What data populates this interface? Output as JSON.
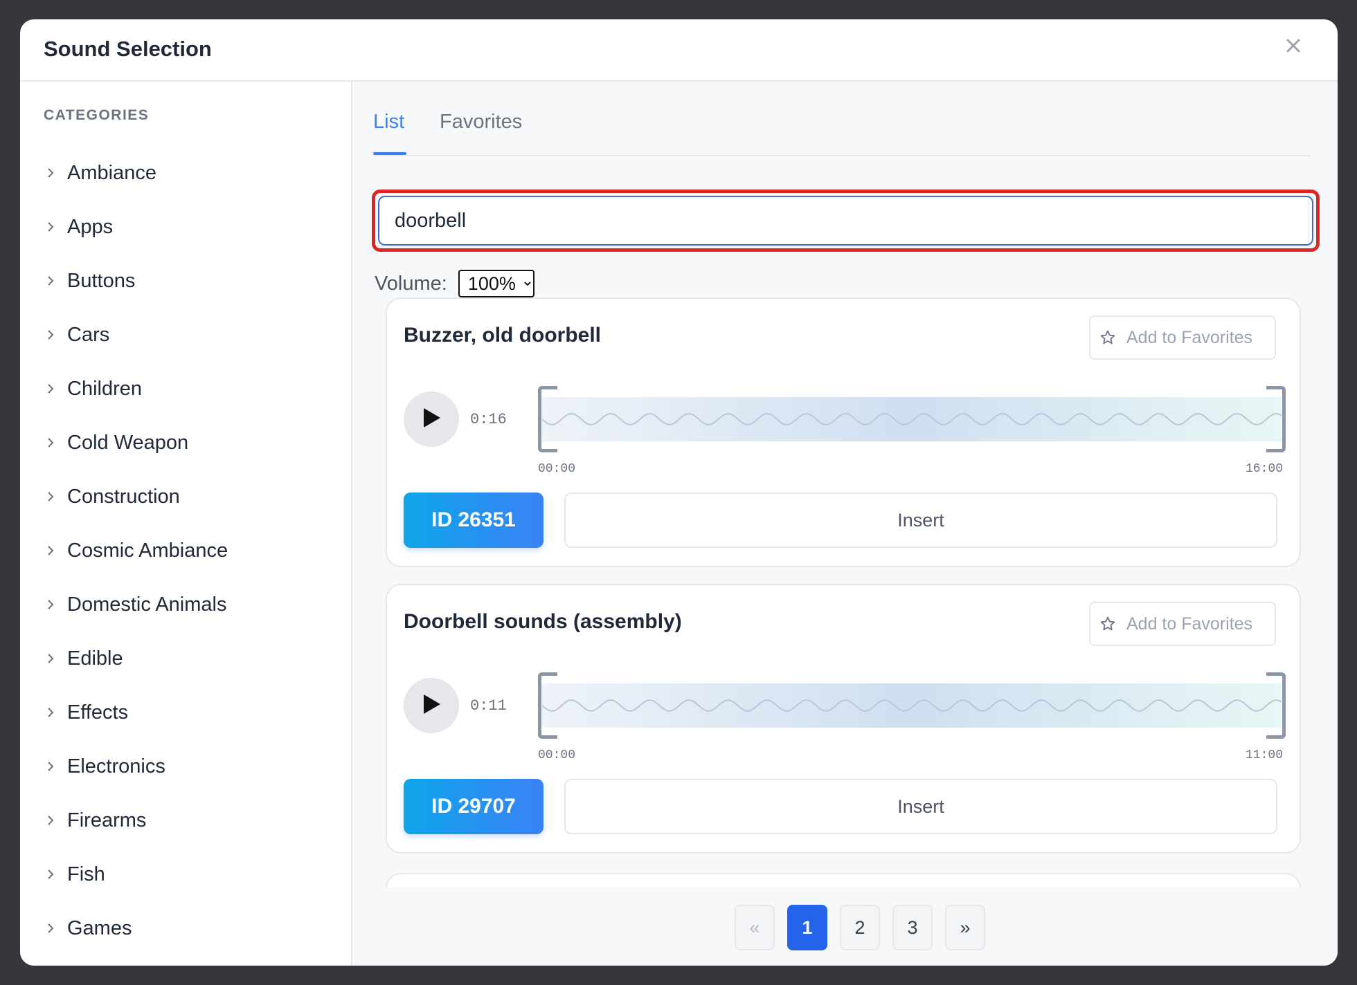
{
  "modal": {
    "title": "Sound Selection",
    "close_icon": "close-icon"
  },
  "sidebar": {
    "heading": "CATEGORIES",
    "items": [
      {
        "label": "Ambiance"
      },
      {
        "label": "Apps"
      },
      {
        "label": "Buttons"
      },
      {
        "label": "Cars"
      },
      {
        "label": "Children"
      },
      {
        "label": "Cold Weapon"
      },
      {
        "label": "Construction"
      },
      {
        "label": "Cosmic Ambiance"
      },
      {
        "label": "Domestic Animals"
      },
      {
        "label": "Edible"
      },
      {
        "label": "Effects"
      },
      {
        "label": "Electronics"
      },
      {
        "label": "Firearms"
      },
      {
        "label": "Fish"
      },
      {
        "label": "Games"
      }
    ]
  },
  "tabs": {
    "list": "List",
    "favorites": "Favorites",
    "active": "List"
  },
  "search": {
    "value": "doorbell",
    "placeholder": ""
  },
  "volume": {
    "label": "Volume:",
    "selected": "100%"
  },
  "results": [
    {
      "title": "Buzzer, old doorbell",
      "favorite_label": "Add to Favorites",
      "duration": "0:16",
      "time_start": "00:00",
      "time_end": "16:00",
      "id_label": "ID 26351",
      "insert_label": "Insert"
    },
    {
      "title": "Doorbell sounds (assembly)",
      "favorite_label": "Add to Favorites",
      "duration": "0:11",
      "time_start": "00:00",
      "time_end": "11:00",
      "id_label": "ID 29707",
      "insert_label": "Insert"
    }
  ],
  "pagination": {
    "prev": "«",
    "pages": [
      "1",
      "2",
      "3"
    ],
    "current": "1",
    "next": "»"
  },
  "colors": {
    "accent": "#3b82f6",
    "primary": "#2563eb",
    "highlight": "#dc2626"
  }
}
